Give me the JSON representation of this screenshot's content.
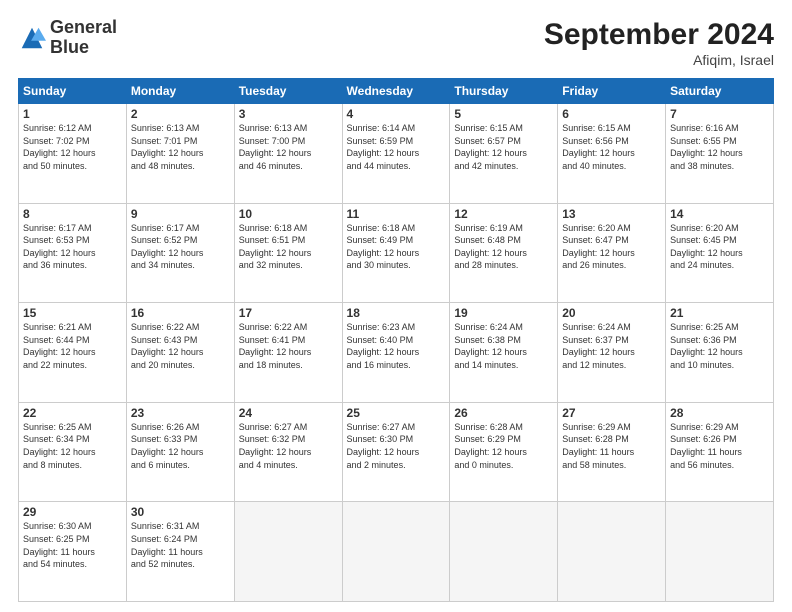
{
  "header": {
    "logo_line1": "General",
    "logo_line2": "Blue",
    "month_title": "September 2024",
    "subtitle": "Afiqim, Israel"
  },
  "weekdays": [
    "Sunday",
    "Monday",
    "Tuesday",
    "Wednesday",
    "Thursday",
    "Friday",
    "Saturday"
  ],
  "weeks": [
    [
      {
        "day": "1",
        "info": "Sunrise: 6:12 AM\nSunset: 7:02 PM\nDaylight: 12 hours\nand 50 minutes."
      },
      {
        "day": "2",
        "info": "Sunrise: 6:13 AM\nSunset: 7:01 PM\nDaylight: 12 hours\nand 48 minutes."
      },
      {
        "day": "3",
        "info": "Sunrise: 6:13 AM\nSunset: 7:00 PM\nDaylight: 12 hours\nand 46 minutes."
      },
      {
        "day": "4",
        "info": "Sunrise: 6:14 AM\nSunset: 6:59 PM\nDaylight: 12 hours\nand 44 minutes."
      },
      {
        "day": "5",
        "info": "Sunrise: 6:15 AM\nSunset: 6:57 PM\nDaylight: 12 hours\nand 42 minutes."
      },
      {
        "day": "6",
        "info": "Sunrise: 6:15 AM\nSunset: 6:56 PM\nDaylight: 12 hours\nand 40 minutes."
      },
      {
        "day": "7",
        "info": "Sunrise: 6:16 AM\nSunset: 6:55 PM\nDaylight: 12 hours\nand 38 minutes."
      }
    ],
    [
      {
        "day": "8",
        "info": "Sunrise: 6:17 AM\nSunset: 6:53 PM\nDaylight: 12 hours\nand 36 minutes."
      },
      {
        "day": "9",
        "info": "Sunrise: 6:17 AM\nSunset: 6:52 PM\nDaylight: 12 hours\nand 34 minutes."
      },
      {
        "day": "10",
        "info": "Sunrise: 6:18 AM\nSunset: 6:51 PM\nDaylight: 12 hours\nand 32 minutes."
      },
      {
        "day": "11",
        "info": "Sunrise: 6:18 AM\nSunset: 6:49 PM\nDaylight: 12 hours\nand 30 minutes."
      },
      {
        "day": "12",
        "info": "Sunrise: 6:19 AM\nSunset: 6:48 PM\nDaylight: 12 hours\nand 28 minutes."
      },
      {
        "day": "13",
        "info": "Sunrise: 6:20 AM\nSunset: 6:47 PM\nDaylight: 12 hours\nand 26 minutes."
      },
      {
        "day": "14",
        "info": "Sunrise: 6:20 AM\nSunset: 6:45 PM\nDaylight: 12 hours\nand 24 minutes."
      }
    ],
    [
      {
        "day": "15",
        "info": "Sunrise: 6:21 AM\nSunset: 6:44 PM\nDaylight: 12 hours\nand 22 minutes."
      },
      {
        "day": "16",
        "info": "Sunrise: 6:22 AM\nSunset: 6:43 PM\nDaylight: 12 hours\nand 20 minutes."
      },
      {
        "day": "17",
        "info": "Sunrise: 6:22 AM\nSunset: 6:41 PM\nDaylight: 12 hours\nand 18 minutes."
      },
      {
        "day": "18",
        "info": "Sunrise: 6:23 AM\nSunset: 6:40 PM\nDaylight: 12 hours\nand 16 minutes."
      },
      {
        "day": "19",
        "info": "Sunrise: 6:24 AM\nSunset: 6:38 PM\nDaylight: 12 hours\nand 14 minutes."
      },
      {
        "day": "20",
        "info": "Sunrise: 6:24 AM\nSunset: 6:37 PM\nDaylight: 12 hours\nand 12 minutes."
      },
      {
        "day": "21",
        "info": "Sunrise: 6:25 AM\nSunset: 6:36 PM\nDaylight: 12 hours\nand 10 minutes."
      }
    ],
    [
      {
        "day": "22",
        "info": "Sunrise: 6:25 AM\nSunset: 6:34 PM\nDaylight: 12 hours\nand 8 minutes."
      },
      {
        "day": "23",
        "info": "Sunrise: 6:26 AM\nSunset: 6:33 PM\nDaylight: 12 hours\nand 6 minutes."
      },
      {
        "day": "24",
        "info": "Sunrise: 6:27 AM\nSunset: 6:32 PM\nDaylight: 12 hours\nand 4 minutes."
      },
      {
        "day": "25",
        "info": "Sunrise: 6:27 AM\nSunset: 6:30 PM\nDaylight: 12 hours\nand 2 minutes."
      },
      {
        "day": "26",
        "info": "Sunrise: 6:28 AM\nSunset: 6:29 PM\nDaylight: 12 hours\nand 0 minutes."
      },
      {
        "day": "27",
        "info": "Sunrise: 6:29 AM\nSunset: 6:28 PM\nDaylight: 11 hours\nand 58 minutes."
      },
      {
        "day": "28",
        "info": "Sunrise: 6:29 AM\nSunset: 6:26 PM\nDaylight: 11 hours\nand 56 minutes."
      }
    ],
    [
      {
        "day": "29",
        "info": "Sunrise: 6:30 AM\nSunset: 6:25 PM\nDaylight: 11 hours\nand 54 minutes."
      },
      {
        "day": "30",
        "info": "Sunrise: 6:31 AM\nSunset: 6:24 PM\nDaylight: 11 hours\nand 52 minutes."
      },
      {
        "day": "",
        "info": ""
      },
      {
        "day": "",
        "info": ""
      },
      {
        "day": "",
        "info": ""
      },
      {
        "day": "",
        "info": ""
      },
      {
        "day": "",
        "info": ""
      }
    ]
  ]
}
